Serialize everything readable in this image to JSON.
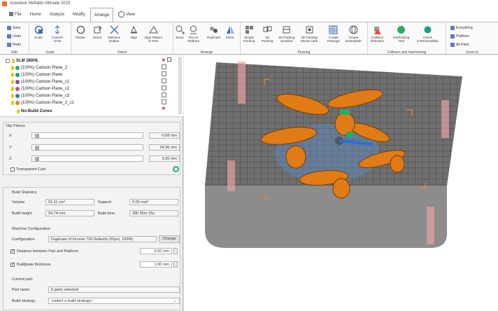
{
  "title": {
    "text": "Autodesk Netfabb Ultimate 2023"
  },
  "tabs": [
    {
      "label": "File"
    },
    {
      "label": "Home"
    },
    {
      "label": "Analyze"
    },
    {
      "label": "Modify"
    },
    {
      "label": "Arrange"
    },
    {
      "label": "View"
    }
  ],
  "ribbon": {
    "edit": {
      "save": "Save",
      "undo": "Undo",
      "redo": "Redo",
      "label": "Edit"
    },
    "scale": {
      "scale": "Scale",
      "convert1": "Convert",
      "convert2": "Units",
      "label": "Scale"
    },
    "orient": {
      "rotate": "Rotate",
      "orient": "Orient",
      "minimize1": "Minimize",
      "minimize2": "Outbox",
      "align": "Align",
      "alignp1": "Align Pattern",
      "alignp2": "to Part",
      "label": "Orient"
    },
    "arrange": {
      "move": "Move",
      "putp1": "Put on",
      "putp2": "Platform",
      "dup": "Duplicate",
      "mirror": "Mirror",
      "label": "Arrange"
    },
    "packing": {
      "simple1": "Simple",
      "simple2": "Packing",
      "p2d1": "2D",
      "p2d2": "Packing",
      "p3d1": "3D Packing",
      "p3d2": "Scanline",
      "p3dm1": "3D Packing",
      "p3dm2": "Monte-carlo",
      "cp1": "Create",
      "cp2": "Package",
      "cb1": "Create",
      "cb2": "Bosesplate",
      "label": "Packing"
    },
    "collision": {
      "cd1": "Collision",
      "cd2": "Detection",
      "it1": "Interlocking",
      "it2": "Test",
      "cz1": "Check",
      "cz2": "Z-Removability",
      "label": "Collision and Interlocking"
    },
    "zoom": {
      "everything": "Everything",
      "platform": "Platform",
      "allparts": "All Parts",
      "label": "Zoom to"
    }
  },
  "tree": {
    "root": "SLM 280HL",
    "items": [
      {
        "label": "(100%) Cartoon Plane_2",
        "color": "#27ae60"
      },
      {
        "label": "(100%) Cartoon Plane",
        "color": "#16a085"
      },
      {
        "label": "(100%) Cartoon Plane_c1",
        "color": "#8e44ad"
      },
      {
        "label": "(100%) Cartoon Plane_c2",
        "color": "#9b59b6"
      },
      {
        "label": "(100%) Cartoon Plane_c3",
        "color": "#2980b9"
      },
      {
        "label": "(100%) Cartoon Plane_2_c1",
        "color": "#e67e22"
      }
    ],
    "nobuild": "No-Build Zones"
  },
  "clip": {
    "title": "Clip Planes",
    "x_label": "X",
    "y_label": "Y",
    "z_label": "Z",
    "x_val": "-0.68 mm",
    "y_val": "24.96 mm",
    "z_val": "5.00 mm",
    "transparent": "Transparent Cuts"
  },
  "stats": {
    "title": "Build Statistics",
    "volume_label": "Volume",
    "volume": "91.11 cm³",
    "support_label": "Support",
    "support": "0.00 mm³",
    "height_label": "Build height",
    "height": "54.74 mm",
    "time_label": "Build time",
    "time": "28h 50m 15s"
  },
  "machine": {
    "title": "Machine Configuration",
    "config_label": "Configuration",
    "config": "Duplicate of Inconel 718 Defaults (20µm, 100W)",
    "change": "Change",
    "dist_label": "Distance between Part and Platform",
    "dist": "5.00 mm",
    "base_label": "Buildplate thickness",
    "base": "1.00 mm"
  },
  "current": {
    "title": "Current part",
    "name_label": "Part name",
    "name": "6 parts selected",
    "strategy_label": "Build strategy",
    "strategy": "<select a build strategy>"
  }
}
